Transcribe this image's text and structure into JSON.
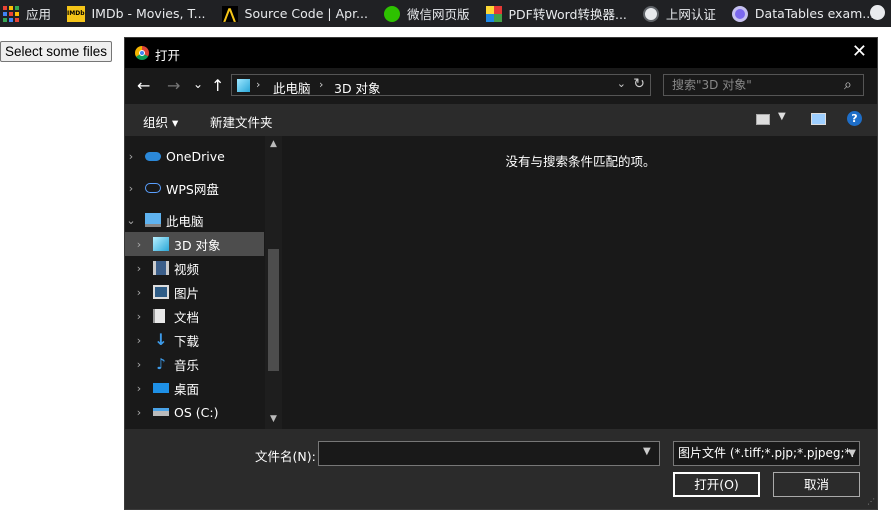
{
  "bookmarks": [
    {
      "label": "应用",
      "icon": "apps-grid-icon"
    },
    {
      "label": "IMDb - Movies, T...",
      "icon": "imdb-icon"
    },
    {
      "label": "Source Code | Apr...",
      "icon": "source-code-icon"
    },
    {
      "label": "微信网页版",
      "icon": "wechat-icon"
    },
    {
      "label": "PDF转Word转换器...",
      "icon": "pdf-converter-icon"
    },
    {
      "label": "上网认证",
      "icon": "network-auth-icon"
    },
    {
      "label": "DataTables exam...",
      "icon": "datatables-icon"
    }
  ],
  "page": {
    "select_button": "Select some files"
  },
  "dialog": {
    "title": "打开",
    "close_glyph": "✕",
    "nav": {
      "back": "←",
      "forward": "→",
      "recent": "⌄",
      "up": "↑"
    },
    "address": {
      "segments": [
        "此电脑",
        "3D 对象"
      ],
      "separator": "›"
    },
    "search_placeholder": "搜索\"3D 对象\"",
    "toolbar": {
      "organize": "组织 ▾",
      "new_folder": "新建文件夹"
    },
    "tree": [
      {
        "label": "OneDrive",
        "icon": "onedrive-icon",
        "chevron": "›"
      },
      {
        "label": "WPS网盘",
        "icon": "wps-cloud-icon",
        "chevron": "›"
      },
      {
        "label": "此电脑",
        "icon": "this-pc-icon",
        "chevron": "⌄"
      },
      {
        "label": "3D 对象",
        "icon": "3d-objects-icon",
        "chevron": "›",
        "selected": true
      },
      {
        "label": "视频",
        "icon": "videos-icon",
        "chevron": "›"
      },
      {
        "label": "图片",
        "icon": "pictures-icon",
        "chevron": "›"
      },
      {
        "label": "文档",
        "icon": "documents-icon",
        "chevron": "›"
      },
      {
        "label": "下载",
        "icon": "downloads-icon",
        "chevron": "›"
      },
      {
        "label": "音乐",
        "icon": "music-icon",
        "chevron": "›"
      },
      {
        "label": "桌面",
        "icon": "desktop-icon",
        "chevron": "›"
      },
      {
        "label": "OS (C:)",
        "icon": "drive-icon",
        "chevron": "›"
      }
    ],
    "empty_message": "没有与搜索条件匹配的项。",
    "filename_label": "文件名(N):",
    "filename_value": "",
    "filter_value": "图片文件 (*.tiff;*.pjp;*.pjpeg;*.",
    "open_button": "打开(O)",
    "cancel_button": "取消"
  },
  "colors": {
    "dialog_bg": "#191919",
    "toolbar_bg": "#2b2b2b",
    "selected_bg": "#4d4d4d",
    "help_blue": "#1e6ec8"
  }
}
